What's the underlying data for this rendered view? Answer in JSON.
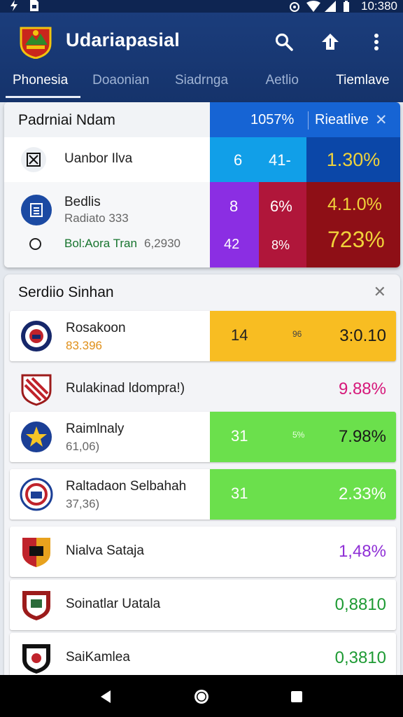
{
  "status_bar": {
    "time": "10:380"
  },
  "app": {
    "title": "Udariapasial",
    "tabs": [
      {
        "label": "Phonesia"
      },
      {
        "label": "Doaonian"
      },
      {
        "label": "Siadrnga"
      },
      {
        "label": "Aetlio"
      },
      {
        "label": "Tiemlave"
      }
    ]
  },
  "card1": {
    "title": "Padrniai Ndam",
    "header_pct": "1057%",
    "header_rel": "Rieatlive",
    "row1": {
      "name": "Uanbor Ilva",
      "v1": "6",
      "v2": "41-",
      "pct": "1.30%"
    },
    "row2": {
      "name": "Bedlis",
      "sub": "Radiato 333",
      "line3": "Bol:Aora Tran",
      "line3_value": "6,2930",
      "v1": "8",
      "v2": "6%",
      "v3": "42",
      "v4": "8%",
      "pct1": "4.1.0%",
      "pct2": "723%"
    }
  },
  "card2": {
    "title": "Serdiio Sinhan",
    "rows": [
      {
        "name": "Rosakoon",
        "sub": "83.396",
        "n1": "14",
        "n2": "96",
        "pct": "3:0.10"
      },
      {
        "name": "Rulakinad ldompra!)",
        "pct": "9.88%"
      },
      {
        "name": "Raimlnaly",
        "sub": "61,06)",
        "n1": "31",
        "n2": "5%",
        "pct": "7.98%"
      },
      {
        "name": "Raltadaon Selbahah",
        "sub": "37,36)",
        "n1": "31",
        "pct": "2.33%"
      },
      {
        "name": "Nialva Sataja",
        "pct": "1,48%"
      },
      {
        "name": "Soinatlar Uatala",
        "pct": "0,8810"
      },
      {
        "name": "SaiKamlea",
        "pct": "0,3810"
      }
    ]
  },
  "colors": {
    "appbar": "#1b3d7c",
    "blue_header": "#1664d4",
    "cyan": "#119fe8",
    "dark_blue": "#0b47a8",
    "purple": "#8b2ee3",
    "crimson": "#b0163a",
    "dark_red": "#8e0f16",
    "gold_text": "#f0d23a",
    "yellow": "#f8bd22",
    "green": "#6be04c",
    "pink": "#d6177a",
    "violet": "#8f2fd6",
    "green_text": "#1d9a33"
  },
  "icons": {
    "status_left": [
      "bolt-icon",
      "sim-icon"
    ],
    "status_right": [
      "alarm-icon",
      "wifi-icon",
      "signal-icon",
      "battery-icon"
    ],
    "app_actions": [
      "search-icon",
      "share-icon",
      "more-vert-icon"
    ],
    "nav": [
      "back-icon",
      "home-icon",
      "recents-icon"
    ]
  }
}
